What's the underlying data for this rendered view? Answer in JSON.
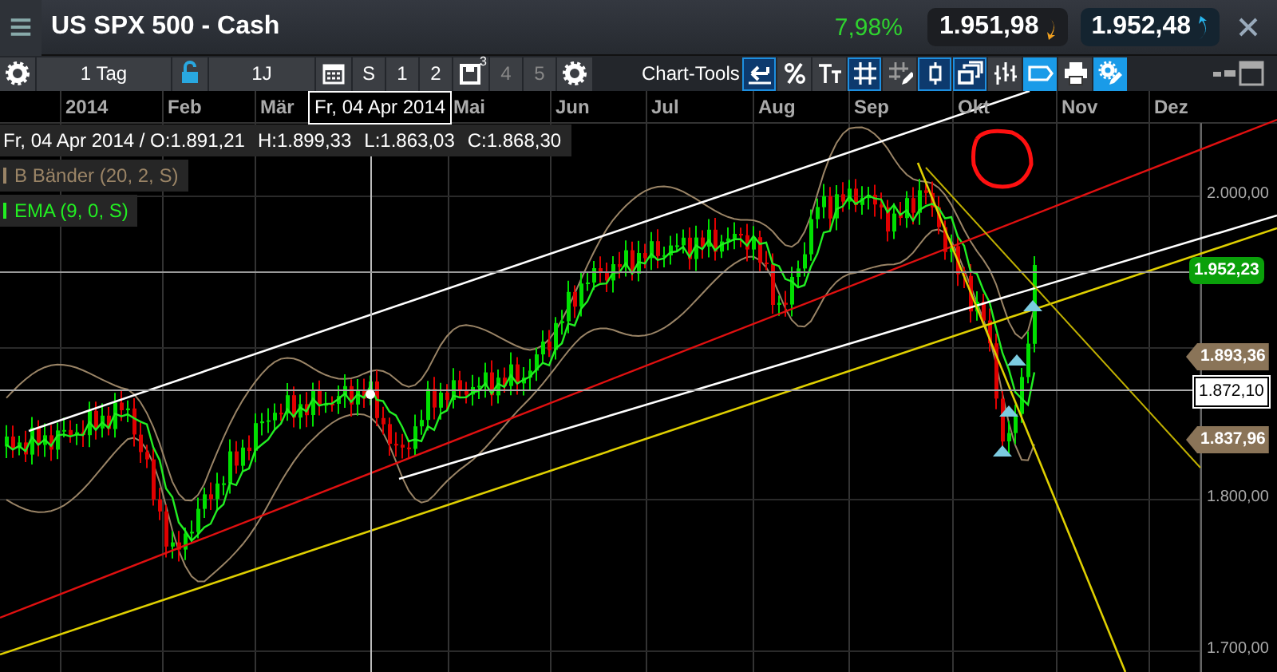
{
  "window": {
    "title": "US SPX 500 - Cash",
    "change": "7,98%",
    "sell_price": "1.951,98",
    "buy_price": "1.952,48"
  },
  "toolbar": [
    {
      "kind": "icon"
    },
    {
      "kind": "text",
      "label": "1 Tag",
      "disabled": false
    },
    {
      "kind": "icon"
    },
    {
      "kind": "text",
      "label": "1J",
      "disabled": false
    },
    {
      "kind": "icon"
    },
    {
      "kind": "text",
      "label": "S",
      "disabled": false
    },
    {
      "kind": "text",
      "label": "1",
      "disabled": false
    },
    {
      "kind": "text",
      "label": "2",
      "disabled": false
    },
    {
      "kind": "save",
      "label": "3",
      "disabled": false
    },
    {
      "kind": "text",
      "label": "4",
      "disabled": true
    },
    {
      "kind": "text",
      "label": "5",
      "disabled": true
    },
    {
      "kind": "icon"
    }
  ],
  "chart_tools": {
    "label": "Chart-Tools",
    "tools": [
      {
        "selected": true
      },
      {
        "selected": false
      },
      {
        "selected": false
      },
      {
        "selected": true
      },
      {
        "selected": false
      },
      {
        "selected": true
      },
      {
        "selected": true
      },
      {
        "selected": false
      },
      {
        "selected": true
      },
      {
        "selected": false
      },
      {
        "selected": true
      }
    ]
  },
  "chart": {
    "months": [
      "2014",
      "Feb",
      "Mär",
      "Mai",
      "Jun",
      "Jul",
      "Aug",
      "Sep",
      "Okt",
      "Nov",
      "Dez"
    ],
    "cursor_date": "Fr, 04 Apr 2014",
    "ohlc": [
      "Fr, 04 Apr 2014 / O:1.891,21",
      "H:1.899,33",
      "L:1.863,03",
      "C:1.868,30"
    ],
    "indicators": [
      {
        "label": "B Bänder (20, 2, S)",
        "color": "#9a8466"
      },
      {
        "label": "EMA (9, 0, S)",
        "color": "#22ee22"
      }
    ],
    "price_axis": [
      "2.000,00",
      "1.800,00",
      "1.700,00"
    ],
    "price_tags": [
      {
        "kind": "last",
        "text": "1.952,23"
      },
      {
        "kind": "level",
        "text": "1.893,36"
      },
      {
        "kind": "cursor",
        "text": "1.872,10"
      },
      {
        "kind": "level",
        "text": "1.837,96"
      }
    ]
  }
}
